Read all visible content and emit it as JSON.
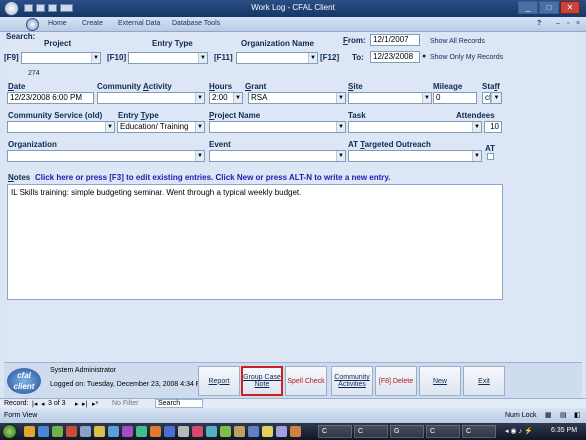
{
  "window": {
    "title": "Work Log - CFAL Client",
    "help": "?"
  },
  "ribbon": {
    "tabs": [
      "Home",
      "Create",
      "External Data",
      "Database Tools"
    ]
  },
  "search": {
    "label": "Search:",
    "project": "Project",
    "entry_type": "Entry Type",
    "org_name": "Organization Name",
    "f9": "[F9]",
    "f10": "[F10]",
    "f11": "[F11]",
    "f12": "[F12]",
    "from_label": "From:",
    "from_value": "12/1/2007",
    "to_label": "To:",
    "to_value": "12/23/2008",
    "show_all": "Show All Records",
    "show_mine": "Show Only My Records"
  },
  "record": {
    "id": "274",
    "date_label": "Date",
    "date_value": "12/23/2008 6:00 PM",
    "community_activity_label": "Community Activity",
    "hours_label": "Hours",
    "hours_value": "2:00",
    "grant_label": "Grant",
    "grant_value": "RSA",
    "site_label": "Site",
    "mileage_label": "Mileage",
    "mileage_value": "0",
    "staff_label": "Staff",
    "staff_value": "cf",
    "community_service_label": "Community Service (old)",
    "entry_type_label": "Entry Type",
    "entry_type_value": "Education/ Training",
    "project_name_label": "Project Name",
    "task_label": "Task",
    "attendees_label": "Attendees",
    "attendees_value": "10",
    "organization_label": "Organization",
    "event_label": "Event",
    "at_targeted_label": "AT Targeted Outreach",
    "at_label": "AT"
  },
  "notes": {
    "label": "Notes",
    "hint": "Click here or press [F3] to edit existing entries. Click New or press ALT-N to write a new entry.",
    "text": "IL Skills training: simple budgeting seminar. Went through a typical weekly budget."
  },
  "bottom": {
    "logo": "cfal client",
    "user": "System Administrator",
    "logged_on": "Logged on: Tuesday, December 23, 2008 4:34 PM",
    "buttons": {
      "report": "Report",
      "group_case_note": "Group Case Note",
      "spell_check": "Spell Check",
      "community_activities": "Community Activities",
      "delete": "[F8] Delete",
      "new": "New",
      "exit": "Exit"
    }
  },
  "recnav": {
    "label": "Record:",
    "position": "3 of 3",
    "filter": "No Filter",
    "search": "Search"
  },
  "status": {
    "left": "Form View",
    "right": "Num Lock"
  },
  "taskbar": {
    "tasks": [
      "C",
      "C",
      "G",
      "C",
      "C"
    ],
    "time": "6:35 PM"
  },
  "colors": {
    "highlight": "#cc2222",
    "accent": "#15325e",
    "delete": "#b01818"
  }
}
